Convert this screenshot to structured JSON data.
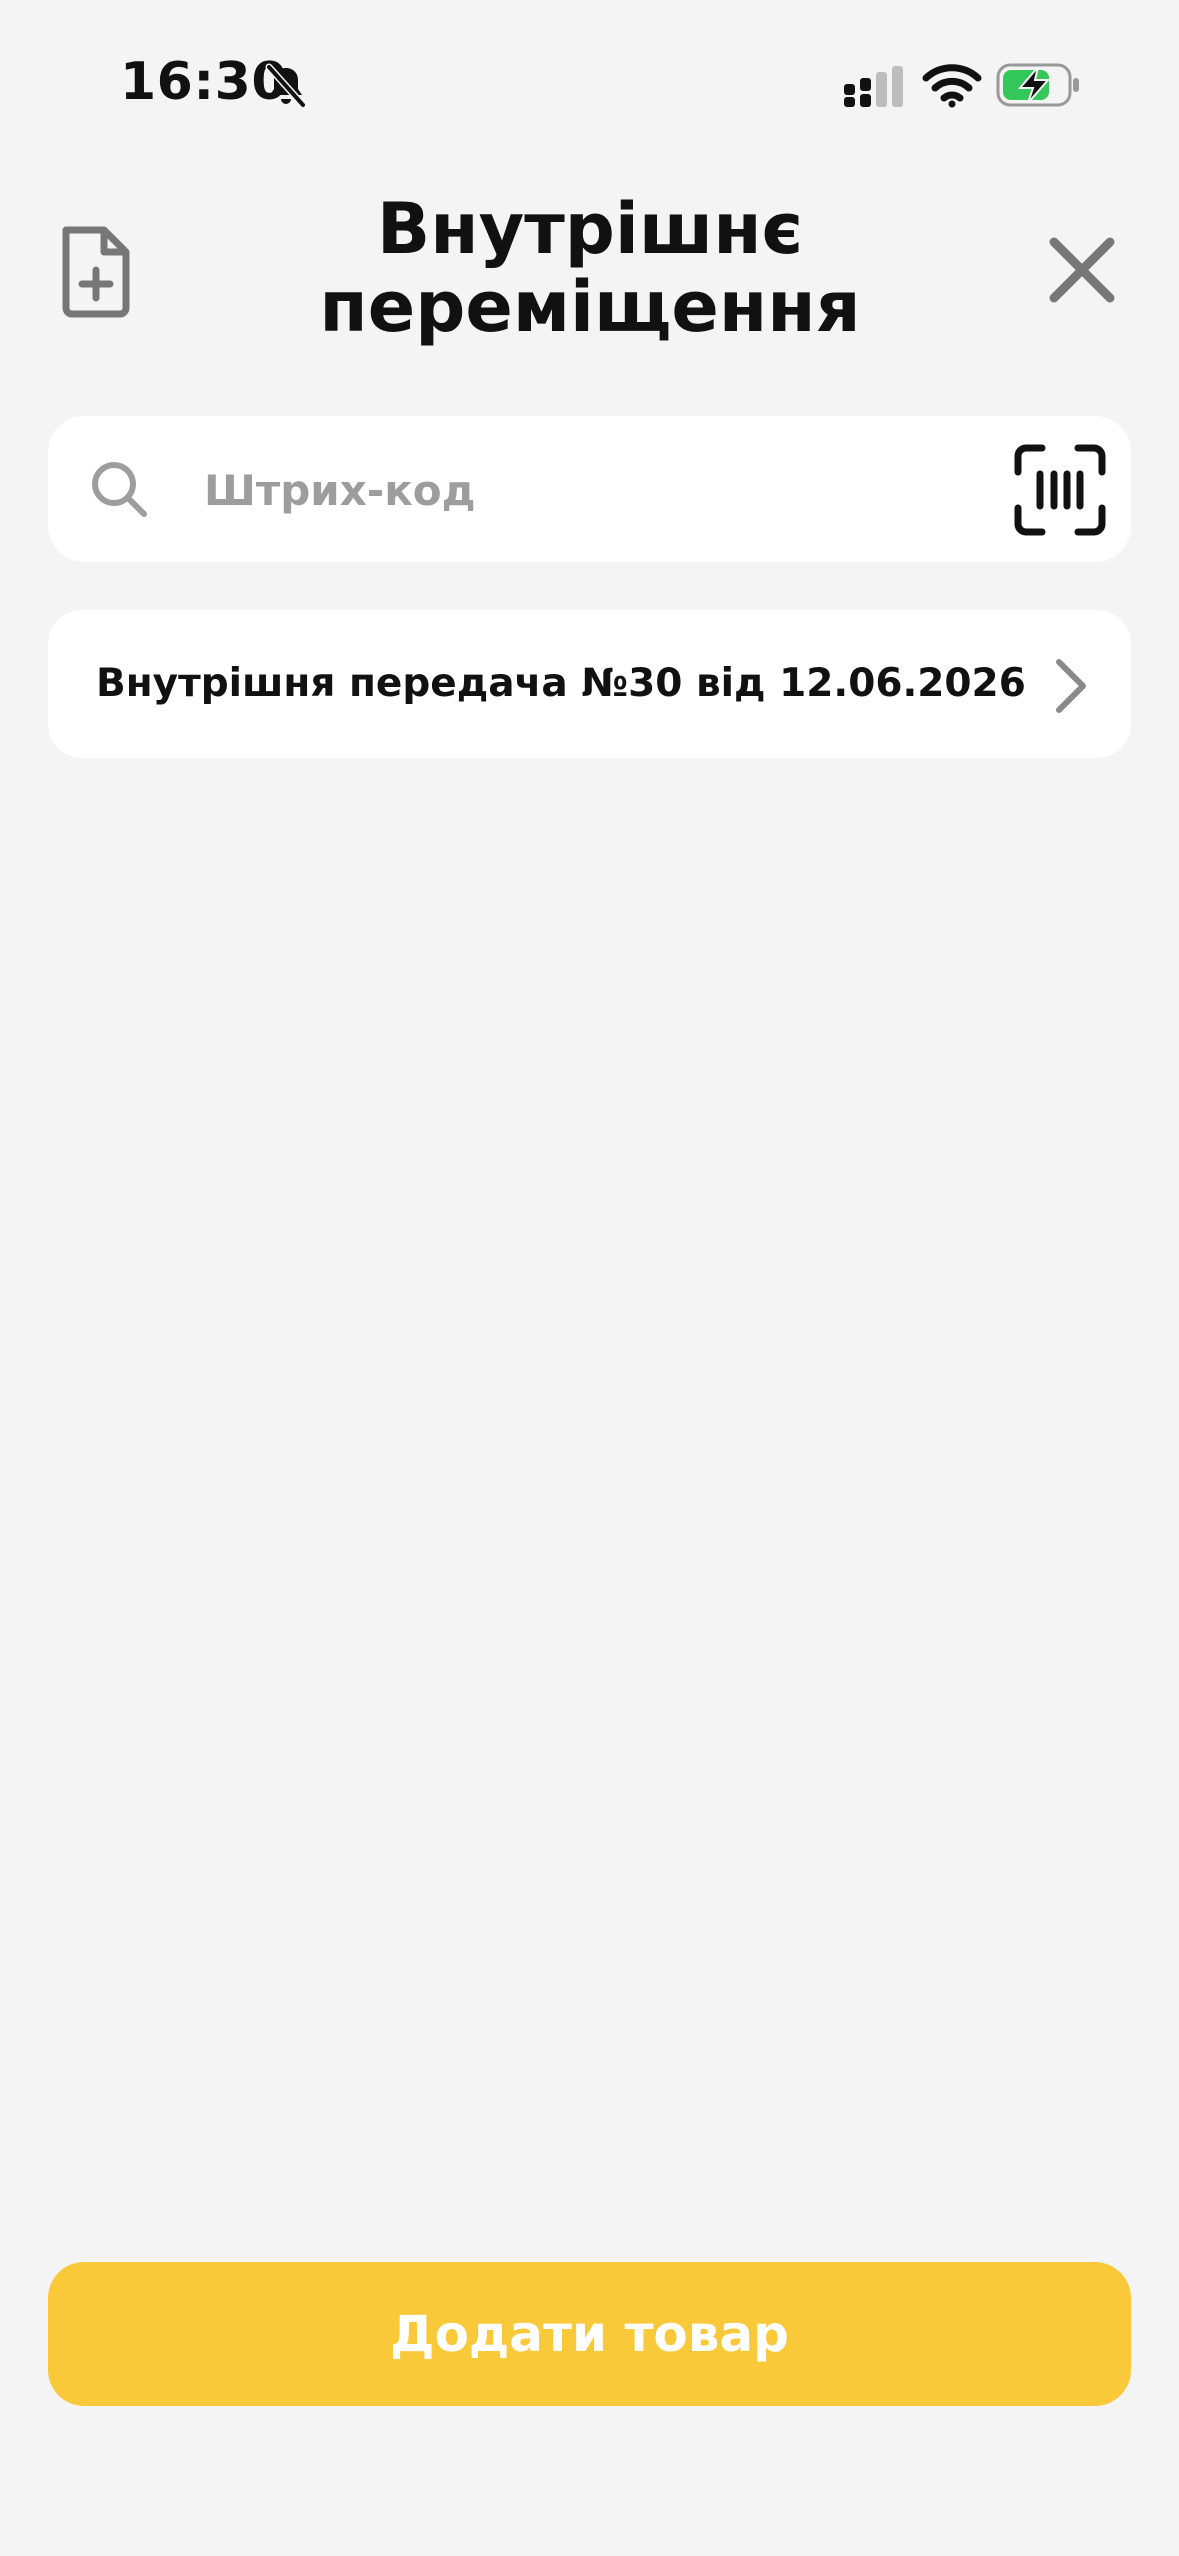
{
  "status_bar": {
    "time": "16:30",
    "icons": [
      "bell-off-icon",
      "signal-icon",
      "wifi-icon",
      "battery-charging-icon"
    ]
  },
  "header": {
    "title": "Внутрішнє переміщення",
    "left_icon": "file-add-icon",
    "right_icon": "close-icon"
  },
  "search": {
    "placeholder": "Штрих-код",
    "value": "",
    "left_icon": "search-icon",
    "right_icon": "barcode-scan-icon"
  },
  "documents": [
    {
      "label": "Внутрішня передача №30 від 12.06.2026"
    }
  ],
  "footer": {
    "add_button_label": "Додати товар"
  },
  "colors": {
    "background": "#f4f4f4",
    "card": "#ffffff",
    "accent": "#f9c93a",
    "icon_gray": "#777777",
    "placeholder": "#9d9d9d",
    "battery_green": "#34c759"
  }
}
